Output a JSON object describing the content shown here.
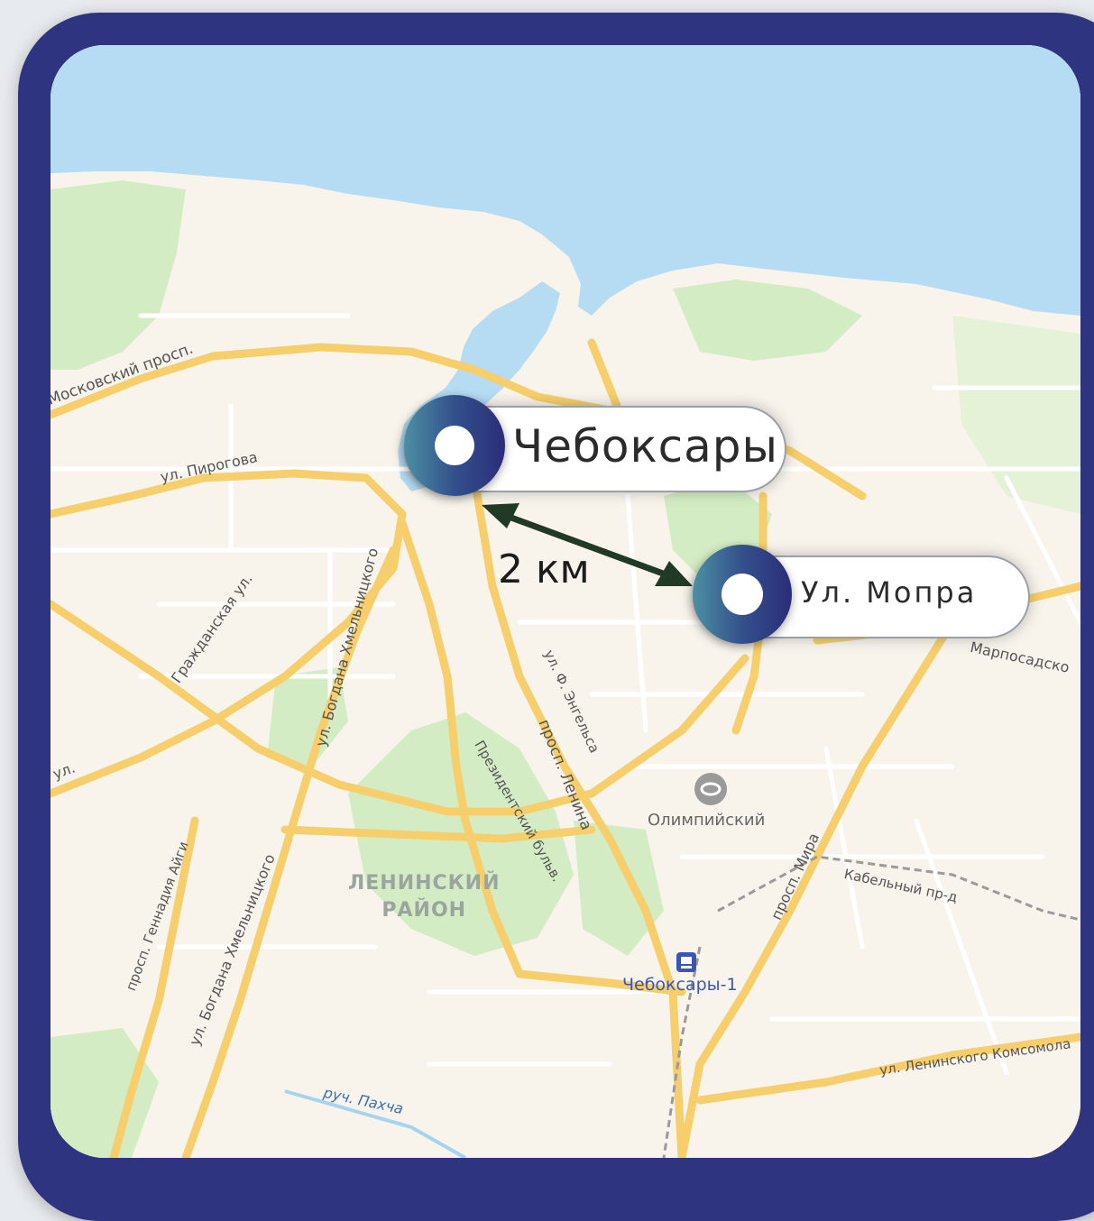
{
  "map": {
    "colors": {
      "frame": "#2e3480",
      "water": "#b5dcf2",
      "land": "#f8f4ec",
      "park": "#d4ecc4",
      "major_road": "#f6cf6c",
      "minor_road": "#ffffff",
      "pin_gradient": [
        "#4c8fa3",
        "#2b2d78"
      ],
      "arrow": "#213a26"
    },
    "markers": [
      {
        "label": "Чебоксары",
        "icon": "location-dot-icon"
      },
      {
        "label": "Ул. Мопра",
        "icon": "location-dot-icon"
      }
    ],
    "distance_label": "2 км",
    "street_labels": {
      "moskovsky": "Московский просп.",
      "pirogova": "ул. Пирогова",
      "grazhdanskaya": "Гражданская ул.",
      "bogdana1": "ул. Богдана Хмельницкого",
      "bogdana2": "ул. Богдана Хмельницкого",
      "aygi": "просп. Геннадия Айги",
      "engelsa": "ул. Ф. Энгельса",
      "lenina": "просп. Ленина",
      "prezident": "Президентский бульв.",
      "mira": "просп. Мира",
      "kabelny": "Кабельный пр-д",
      "marposad": "Марпосадско",
      "komsomola": "ул. Ленинского Комсомола",
      "pakhcha": "руч. Пахча",
      "ul_left": "ул."
    },
    "district_label": [
      "ЛЕНИНСКИЙ",
      "РАЙОН"
    ],
    "poi": [
      {
        "label": "Олимпийский",
        "icon": "stadium-icon"
      },
      {
        "label": "Чебоксары-1",
        "icon": "train-station-icon"
      }
    ]
  }
}
